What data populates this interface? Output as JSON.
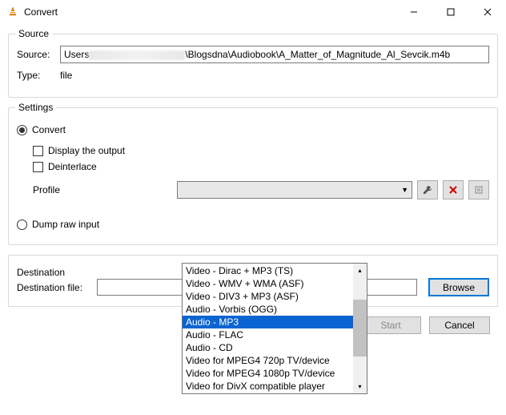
{
  "window": {
    "title": "Convert",
    "min": "—",
    "max": "□",
    "close": "✕"
  },
  "source": {
    "legend": "Source",
    "source_label": "Source:",
    "source_prefix": "Users",
    "source_suffix": "\\Blogsdna\\Audiobook\\A_Matter_of_Magnitude_Al_Sevcik.m4b",
    "type_label": "Type:",
    "type_value": "file"
  },
  "settings": {
    "legend": "Settings",
    "convert": "Convert",
    "display_output": "Display the output",
    "deinterlace": "Deinterlace",
    "profile": "Profile",
    "dump_raw": "Dump raw input",
    "selected_profile": "Audio - MP3",
    "options": [
      "Video - Dirac + MP3 (TS)",
      "Video - WMV + WMA (ASF)",
      "Video - DIV3 + MP3 (ASF)",
      "Audio - Vorbis (OGG)",
      "Audio - MP3",
      "Audio - FLAC",
      "Audio - CD",
      "Video for MPEG4 720p TV/device",
      "Video for MPEG4 1080p TV/device",
      "Video for DivX compatible player"
    ]
  },
  "destination": {
    "legend": "Destination",
    "file_label": "Destination file:",
    "browse": "Browse"
  },
  "footer": {
    "start": "Start",
    "cancel": "Cancel"
  },
  "icons": {
    "wrench": "wrench",
    "delete": "delete",
    "new": "new"
  }
}
